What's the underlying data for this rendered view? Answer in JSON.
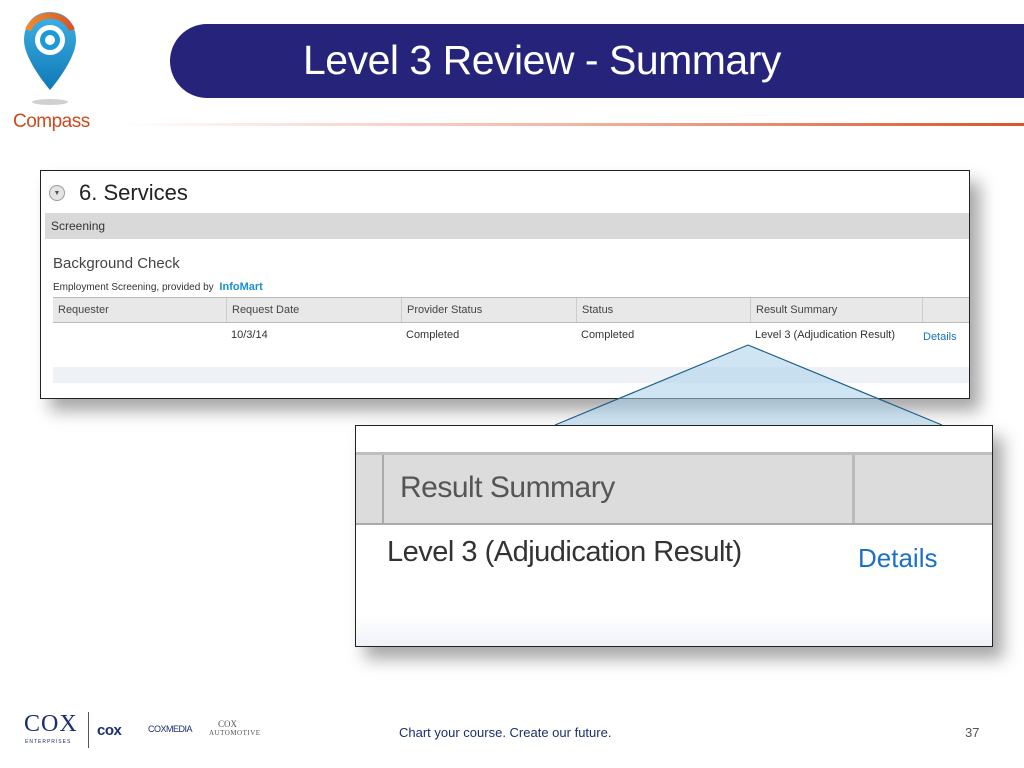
{
  "header": {
    "brand": "Compass",
    "title": "Level 3 Review - Summary"
  },
  "services": {
    "section_title": "6. Services",
    "screening_label": "Screening",
    "background_check_title": "Background Check",
    "provider_prefix": "Employment Screening, provided by",
    "provider_brand": "InfoMart",
    "columns": [
      "Requester",
      "Request Date",
      "Provider Status",
      "Status",
      "Result Summary"
    ],
    "row": {
      "requester": "",
      "request_date": "10/3/14",
      "provider_status": "Completed",
      "status": "Completed",
      "result_summary": "Level 3 (Adjudication Result)",
      "details_link": "Details"
    }
  },
  "zoom": {
    "column_header": "Result Summary",
    "value": "Level 3 (Adjudication Result)",
    "details_link": "Details"
  },
  "footer": {
    "cox_enterprises": "COX",
    "cox_enterprises_sub": "ENTERPRISES",
    "cox_communications": "cox",
    "cox_media": "COXMEDIA",
    "cox_automotive_1": "COX",
    "cox_automotive_2": "AUTOMOTIVE",
    "tagline": "Chart your course. Create our future.",
    "page_number": "37"
  },
  "colors": {
    "title_bar": "#25237a",
    "brand_orange": "#cc4a1f",
    "link_blue": "#1a72c4",
    "pin_blue": "#1a9ad6"
  },
  "icons": [
    "compass-pin-icon",
    "collapse-arrow-icon"
  ]
}
